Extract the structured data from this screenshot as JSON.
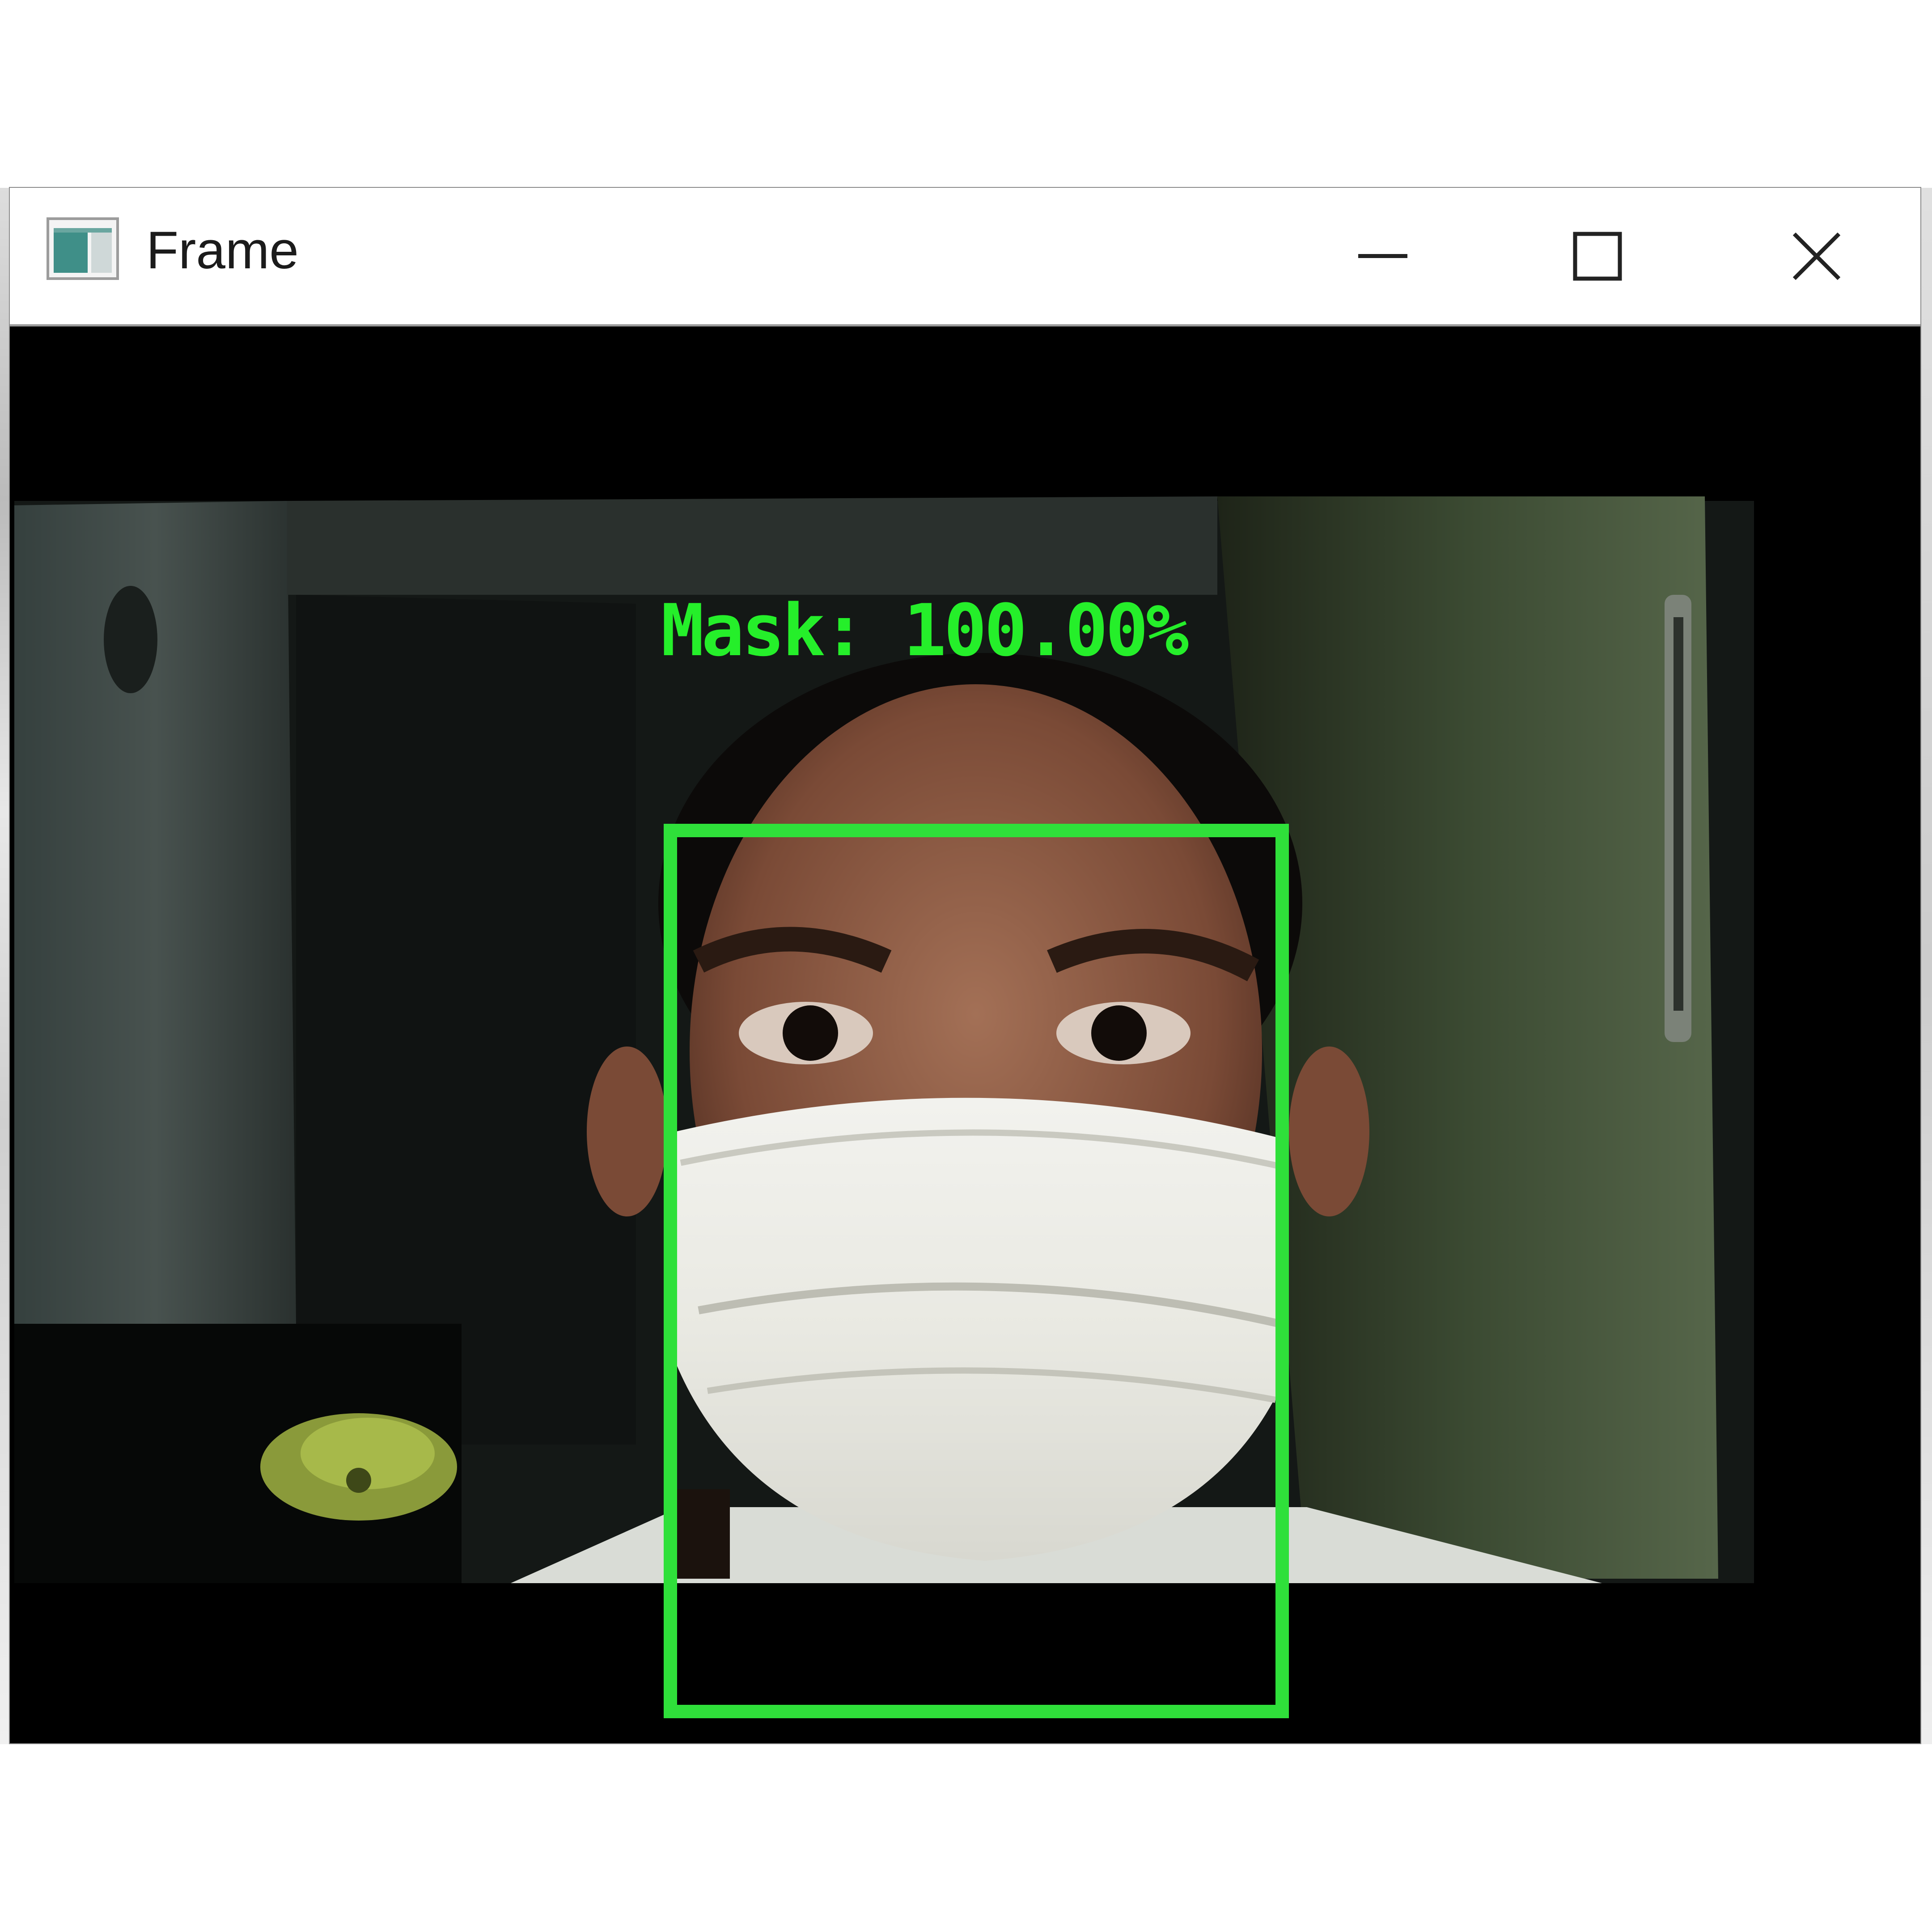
{
  "window": {
    "title": "Frame",
    "controls": [
      "minimize",
      "maximize",
      "close"
    ]
  },
  "detection": {
    "label": "Mask: 100.00%",
    "class": "Mask",
    "confidence_percent": 100.0,
    "box_color": "#2fe03a"
  },
  "icons": {
    "app": "app-window-icon",
    "minimize": "minimize-icon",
    "maximize": "maximize-icon",
    "close": "close-icon"
  }
}
